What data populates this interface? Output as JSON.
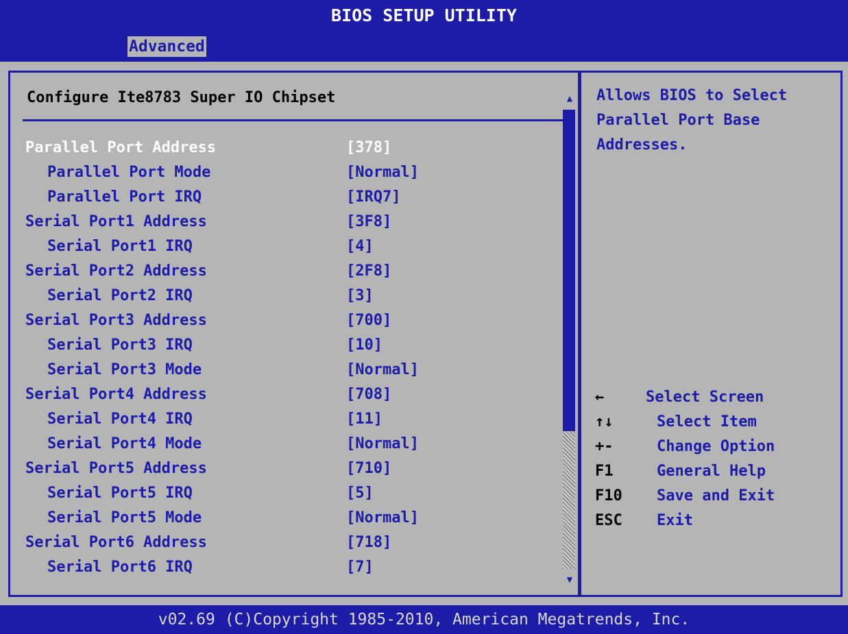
{
  "app": {
    "title": "BIOS SETUP UTILITY",
    "active_tab": "Advanced"
  },
  "colors": {
    "bios_blue": "#1c1ca8",
    "panel_gray": "#b5b5b5",
    "selected_text": "#ffffff",
    "key_text": "#000000"
  },
  "section": {
    "title": "Configure Ite8783 Super IO Chipset"
  },
  "settings": [
    {
      "label": "Parallel Port Address",
      "value": "[378]",
      "indent": 0,
      "selected": true
    },
    {
      "label": "Parallel Port Mode",
      "value": "[Normal]",
      "indent": 1
    },
    {
      "label": "Parallel Port IRQ",
      "value": "[IRQ7]",
      "indent": 1
    },
    {
      "label": "Serial Port1 Address",
      "value": "[3F8]",
      "indent": 0
    },
    {
      "label": "Serial Port1 IRQ",
      "value": "[4]",
      "indent": 1
    },
    {
      "label": "Serial Port2 Address",
      "value": "[2F8]",
      "indent": 0
    },
    {
      "label": "Serial Port2 IRQ",
      "value": "[3]",
      "indent": 1
    },
    {
      "label": "Serial Port3 Address",
      "value": "[700]",
      "indent": 0
    },
    {
      "label": "Serial Port3 IRQ",
      "value": "[10]",
      "indent": 1
    },
    {
      "label": "Serial Port3 Mode",
      "value": "[Normal]",
      "indent": 1
    },
    {
      "label": "Serial Port4 Address",
      "value": "[708]",
      "indent": 0
    },
    {
      "label": "Serial Port4 IRQ",
      "value": "[11]",
      "indent": 1
    },
    {
      "label": "Serial Port4 Mode",
      "value": "[Normal]",
      "indent": 1
    },
    {
      "label": "Serial Port5 Address",
      "value": "[710]",
      "indent": 0
    },
    {
      "label": "Serial Port5 IRQ",
      "value": "[5]",
      "indent": 1
    },
    {
      "label": "Serial Port5 Mode",
      "value": "[Normal]",
      "indent": 1
    },
    {
      "label": "Serial Port6 Address",
      "value": "[718]",
      "indent": 0
    },
    {
      "label": "Serial Port6 IRQ",
      "value": "[7]",
      "indent": 1
    }
  ],
  "scrollbar": {
    "up_glyph": "▲",
    "down_glyph": "▼",
    "thumb_fraction": 0.7
  },
  "help": {
    "text": "Allows BIOS to Select Parallel Port Base Addresses."
  },
  "keys": [
    {
      "key": "←",
      "desc": "Select Screen"
    },
    {
      "key": "↑↓",
      "desc": "Select Item"
    },
    {
      "key": "+-",
      "desc": "Change Option"
    },
    {
      "key": "F1",
      "desc": "General Help"
    },
    {
      "key": "F10",
      "desc": "Save and Exit"
    },
    {
      "key": "ESC",
      "desc": "Exit"
    }
  ],
  "footer": {
    "text": "v02.69 (C)Copyright 1985-2010, American Megatrends, Inc."
  }
}
